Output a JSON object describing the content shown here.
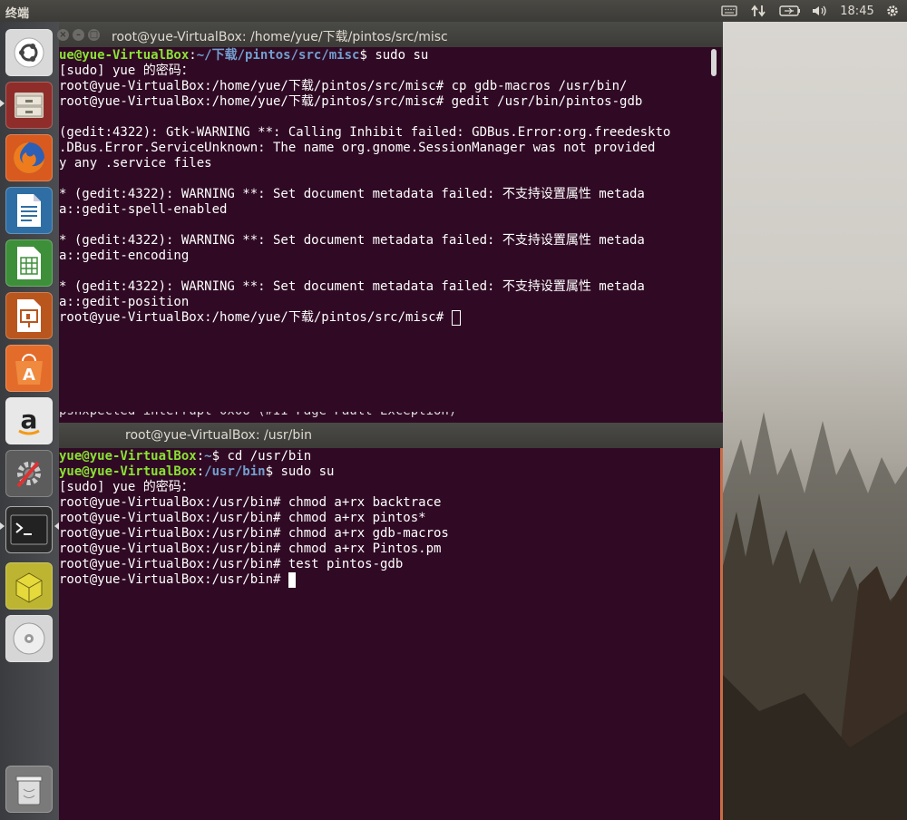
{
  "top_panel": {
    "app_name": "终端",
    "clock": "18:45",
    "icons": [
      "keyboard-icon",
      "network-arrows-icon",
      "battery-icon",
      "volume-icon",
      "gear-icon"
    ]
  },
  "launcher": {
    "items": [
      "ubuntu-dash",
      "files",
      "firefox",
      "libreoffice-writer",
      "libreoffice-calc",
      "libreoffice-impress",
      "software-center",
      "amazon",
      "system-settings",
      "terminal",
      "archive-manager",
      "dvd-drive",
      "trash"
    ]
  },
  "terminal_top": {
    "title": "root@yue-VirtualBox: /home/yue/下载/pintos/src/misc",
    "lines": [
      {
        "prompt_user": "ue@yue-VirtualBox",
        "prompt_sep": ":",
        "prompt_path": "~/下载/pintos/src/misc",
        "prompt_end": "$ ",
        "cmd": "sudo su"
      },
      {
        "text": "[sudo] yue 的密码："
      },
      {
        "text": "root@yue-VirtualBox:/home/yue/下载/pintos/src/misc# cp gdb-macros /usr/bin/"
      },
      {
        "text": "root@yue-VirtualBox:/home/yue/下载/pintos/src/misc# gedit /usr/bin/pintos-gdb"
      },
      {
        "text": ""
      },
      {
        "text": "(gedit:4322): Gtk-WARNING **: Calling Inhibit failed: GDBus.Error:org.freedeskto"
      },
      {
        "text": ".DBus.Error.ServiceUnknown: The name org.gnome.SessionManager was not provided"
      },
      {
        "text": "y any .service files"
      },
      {
        "text": ""
      },
      {
        "text": "* (gedit:4322): WARNING **: Set document metadata failed: 不支持设置属性 metada"
      },
      {
        "text": "a::gedit-spell-enabled"
      },
      {
        "text": ""
      },
      {
        "text": "* (gedit:4322): WARNING **: Set document metadata failed: 不支持设置属性 metada"
      },
      {
        "text": "a::gedit-encoding"
      },
      {
        "text": ""
      },
      {
        "text": "* (gedit:4322): WARNING **: Set document metadata failed: 不支持设置属性 metada"
      },
      {
        "text": "a::gedit-position"
      },
      {
        "text": "root@yue-VirtualBox:/home/yue/下载/pintos/src/misc# ",
        "cursor": "box"
      }
    ],
    "peek_line": "pshxpected interrupt 0x06 (#II Fage Fault Exception)"
  },
  "terminal_bottom": {
    "title": "root@yue-VirtualBox: /usr/bin",
    "lines": [
      {
        "prompt_user": "yue@yue-VirtualBox",
        "prompt_sep": ":",
        "prompt_path": "~",
        "prompt_end": "$ ",
        "cmd": "cd /usr/bin"
      },
      {
        "prompt_user": "yue@yue-VirtualBox",
        "prompt_sep": ":",
        "prompt_path": "/usr/bin",
        "prompt_end": "$ ",
        "cmd": "sudo su"
      },
      {
        "text": "[sudo] yue 的密码："
      },
      {
        "text": "root@yue-VirtualBox:/usr/bin# chmod a+rx backtrace"
      },
      {
        "text": "root@yue-VirtualBox:/usr/bin# chmod a+rx pintos*"
      },
      {
        "text": "root@yue-VirtualBox:/usr/bin# chmod a+rx gdb-macros"
      },
      {
        "text": "root@yue-VirtualBox:/usr/bin# chmod a+rx Pintos.pm"
      },
      {
        "text": "root@yue-VirtualBox:/usr/bin# test pintos-gdb"
      },
      {
        "text": "root@yue-VirtualBox:/usr/bin# ",
        "cursor": "block"
      }
    ]
  }
}
